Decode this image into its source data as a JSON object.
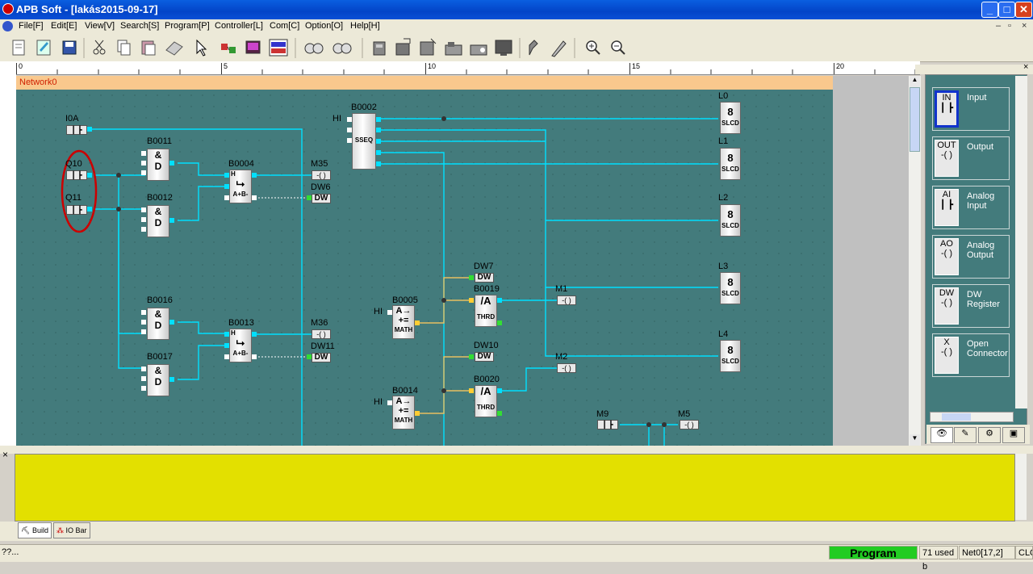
{
  "window": {
    "title": "APB Soft - [lakás2015-09-17]"
  },
  "menu": [
    "File[F]",
    "Edit[E]",
    "View[V]",
    "Search[S]",
    "Program[P]",
    "Controller[L]",
    "Com[C]",
    "Option[O]",
    "Help[H]"
  ],
  "ruler": [
    "0",
    "5",
    "10",
    "15",
    "20"
  ],
  "network": {
    "name": "Network0"
  },
  "inputs": {
    "i0a": "I0A",
    "q10": "Q10",
    "q11": "Q11",
    "m9": "M9"
  },
  "blocks": {
    "b0002": {
      "id": "B0002",
      "type": "SSEQ",
      "in": "HI"
    },
    "b0011": {
      "id": "B0011",
      "op": "&",
      "sub": "D"
    },
    "b0012": {
      "id": "B0012",
      "op": "&",
      "sub": "D"
    },
    "b0016": {
      "id": "B0016",
      "op": "&",
      "sub": "D"
    },
    "b0017": {
      "id": "B0017",
      "op": "&",
      "sub": "D"
    },
    "b0004": {
      "id": "B0004",
      "top": "H",
      "sym": "⮡",
      "bot": "A+B-"
    },
    "b0013": {
      "id": "B0013",
      "top": "H",
      "sym": "⮡",
      "bot": "A+B-"
    },
    "b0005": {
      "id": "B0005",
      "l1": "A→",
      "l2": "+=",
      "type": "MATH",
      "in": "HI"
    },
    "b0014": {
      "id": "B0014",
      "l1": "A→",
      "l2": "+=",
      "type": "MATH",
      "in": "HI"
    },
    "b0019": {
      "id": "B0019",
      "sym": "/A",
      "type": "THRD"
    },
    "b0020": {
      "id": "B0020",
      "sym": "/A",
      "type": "THRD"
    }
  },
  "outputs": {
    "m35": "M35",
    "dw6": "DW6",
    "m36": "M36",
    "dw11": "DW11",
    "dw7": "DW7",
    "dw10": "DW10",
    "m1": "M1",
    "m2": "M2",
    "m5": "M5",
    "dw_tag": "DW"
  },
  "displays": [
    {
      "name": "L0",
      "digit": "8",
      "type": "SLCD"
    },
    {
      "name": "L1",
      "digit": "8",
      "type": "SLCD"
    },
    {
      "name": "L2",
      "digit": "8",
      "type": "SLCD"
    },
    {
      "name": "L3",
      "digit": "8",
      "type": "SLCD"
    },
    {
      "name": "L4",
      "digit": "8",
      "type": "SLCD"
    }
  ],
  "palette": [
    {
      "icon": "IN",
      "label": "Input"
    },
    {
      "icon": "OUT",
      "label": "Output"
    },
    {
      "icon": "AI",
      "label": "Analog Input"
    },
    {
      "icon": "AO",
      "label": "Analog Output"
    },
    {
      "icon": "DW",
      "label": "DW Register"
    },
    {
      "icon": "X",
      "label": "Open Connector"
    }
  ],
  "tabs": {
    "build": "Build",
    "iobar": "IO Bar"
  },
  "status": {
    "hint": "??...",
    "mode": "Program",
    "used": "71 used b",
    "pos": "Net0[17,2]",
    "clock": "CLO"
  },
  "colors": {
    "canvas": "#437b7c",
    "wire": "#00e0ff",
    "header": "#f9c88d",
    "output": "#e3e000",
    "mode": "#22cc22",
    "highlight": "#cc0000"
  }
}
